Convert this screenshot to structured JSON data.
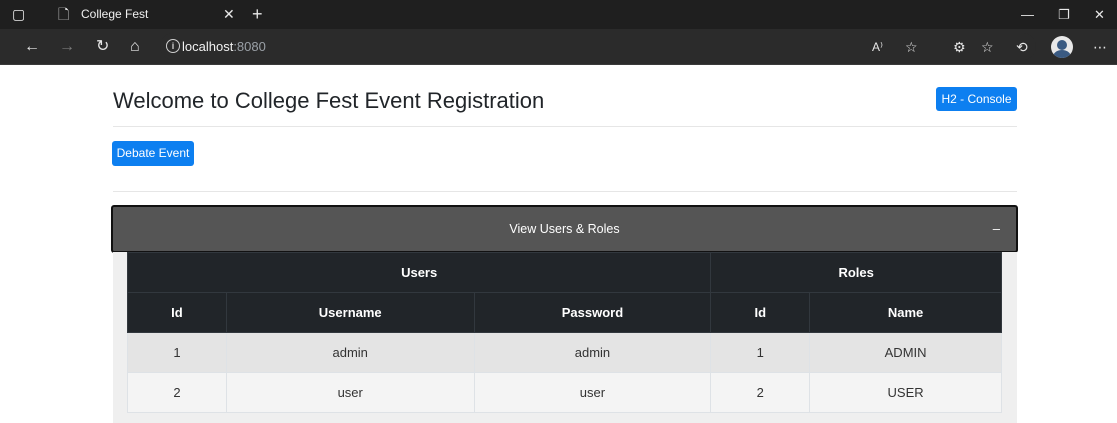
{
  "browser": {
    "tab_title": "College Fest",
    "url_host": "localhost",
    "url_port": ":8080"
  },
  "page": {
    "title": "Welcome to College Fest Event Registration",
    "h2_console_label": "H2 - Console",
    "debate_event_label": "Debate Event",
    "accordion_label": "View Users & Roles",
    "accordion_toggle": "–"
  },
  "table": {
    "group_users": "Users",
    "group_roles": "Roles",
    "headers": [
      "Id",
      "Username",
      "Password",
      "Id",
      "Name"
    ],
    "rows": [
      [
        "1",
        "admin",
        "admin",
        "1",
        "ADMIN"
      ],
      [
        "2",
        "user",
        "user",
        "2",
        "USER"
      ]
    ]
  },
  "colors": {
    "primary": "#0d7ff0",
    "table_header": "#212529",
    "accordion_bg": "#555555"
  }
}
